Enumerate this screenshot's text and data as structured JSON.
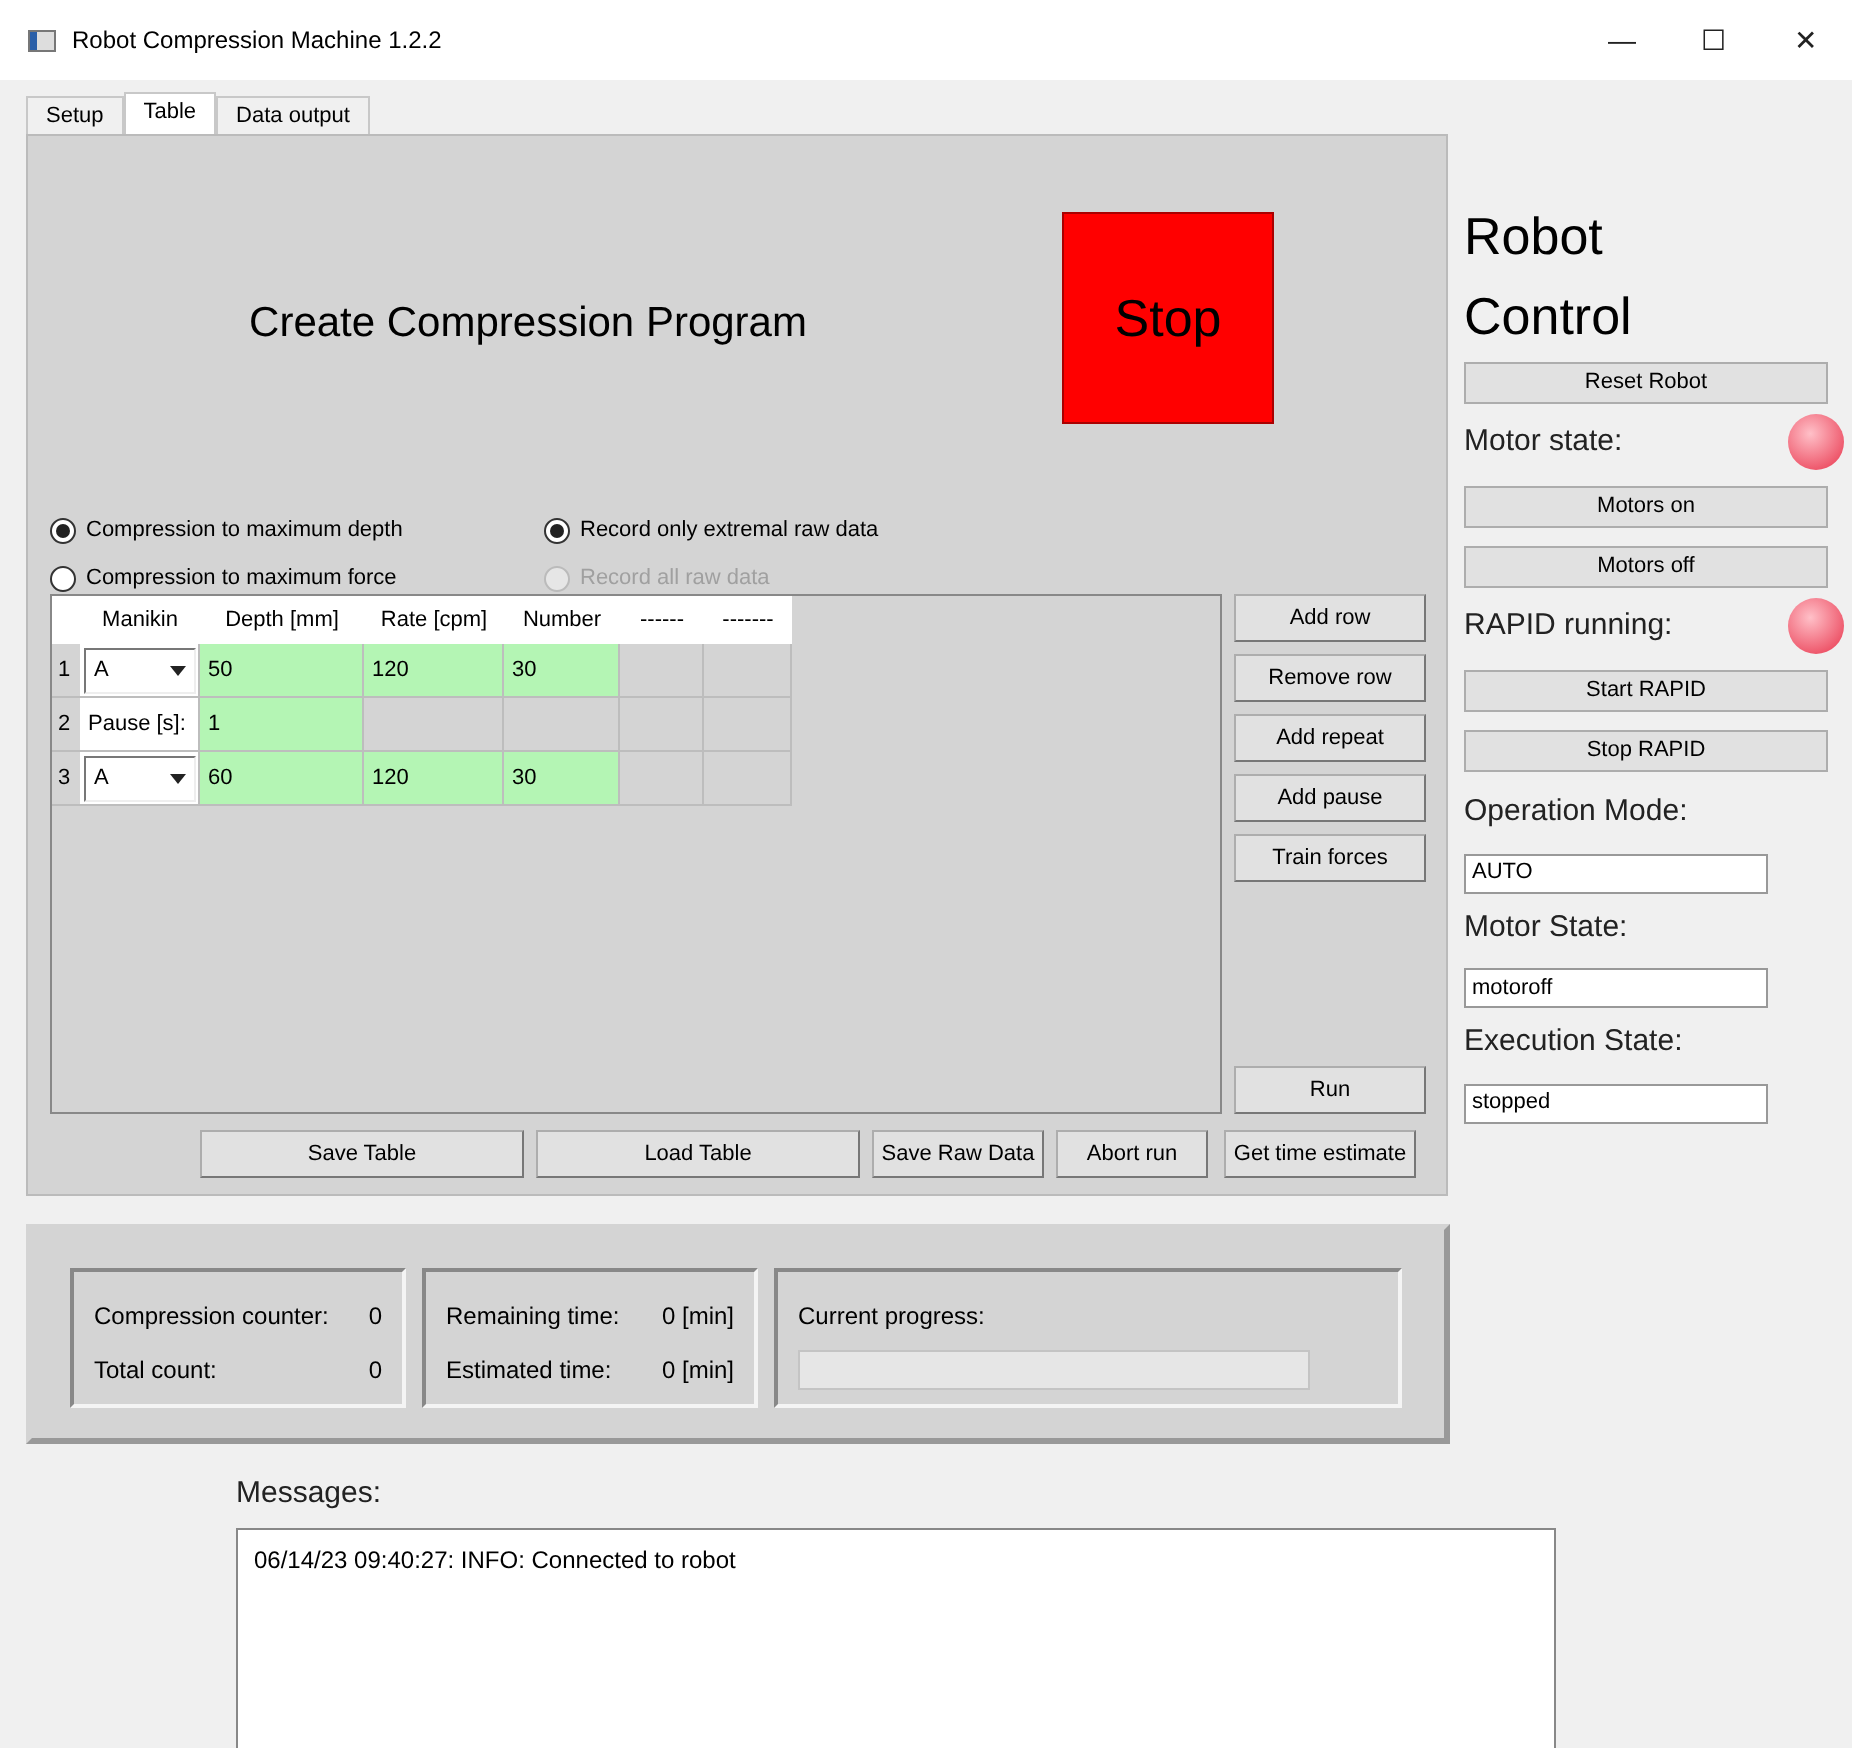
{
  "window": {
    "title": "Robot Compression Machine 1.2.2",
    "controls": [
      "—",
      "☐",
      "✕"
    ]
  },
  "tabs": [
    {
      "label": "Setup",
      "selected": false
    },
    {
      "label": "Table",
      "selected": true
    },
    {
      "label": "Data output",
      "selected": false
    }
  ],
  "program": {
    "heading": "Create Compression Program",
    "stop_button": "Stop",
    "mode_options": [
      {
        "label": "Compression to maximum depth",
        "selected": true,
        "disabled": false
      },
      {
        "label": "Compression to maximum force",
        "selected": false,
        "disabled": false
      }
    ],
    "record_options": [
      {
        "label": "Record only extremal raw data",
        "selected": true,
        "disabled": false
      },
      {
        "label": "Record all raw data",
        "selected": false,
        "disabled": true
      }
    ],
    "table": {
      "columns": [
        "Manikin",
        "Depth [mm]",
        "Rate [cpm]",
        "Number",
        "------",
        "-------"
      ],
      "rows": [
        {
          "kind": "step",
          "number": "1",
          "manikin": "A",
          "values": [
            "50",
            "120",
            "30"
          ]
        },
        {
          "kind": "pause",
          "number": "2",
          "label": "Pause [s]:",
          "values": [
            "1"
          ]
        },
        {
          "kind": "step",
          "number": "3",
          "manikin": "A",
          "values": [
            "60",
            "120",
            "30"
          ]
        }
      ]
    },
    "side_buttons": [
      "Add row",
      "Remove row",
      "Add repeat",
      "Add pause",
      "Train forces"
    ],
    "run_button": "Run",
    "bottom_buttons": [
      "Save Table",
      "Load Table",
      "Save Raw Data",
      "Abort run",
      "Get time estimate"
    ]
  },
  "robot_control": {
    "title": "Robot Control",
    "items": [
      {
        "kind": "button",
        "label": "Reset Robot"
      },
      {
        "kind": "indicator",
        "label": "Motor state:",
        "on": false
      },
      {
        "kind": "button",
        "label": "Motors on"
      },
      {
        "kind": "button",
        "label": "Motors off"
      },
      {
        "kind": "indicator",
        "label": "RAPID running:",
        "on": false
      },
      {
        "kind": "button",
        "label": "Start RAPID"
      },
      {
        "kind": "button",
        "label": "Stop RAPID"
      },
      {
        "kind": "field",
        "label": "Operation Mode:",
        "value": "AUTO"
      },
      {
        "kind": "field",
        "label": "Motor State:",
        "value": "motoroff"
      },
      {
        "kind": "field",
        "label": "Execution State:",
        "value": "stopped"
      }
    ]
  },
  "status": {
    "groups": [
      {
        "rows": [
          {
            "label": "Compression counter:",
            "value": "0"
          },
          {
            "label": "Total count:",
            "value": "0"
          }
        ]
      },
      {
        "rows": [
          {
            "label": "Remaining time:",
            "value": "0 [min]"
          },
          {
            "label": "Estimated time:",
            "value": "0 [min]"
          }
        ]
      }
    ],
    "progress": {
      "label": "Current progress:",
      "level": 0
    }
  },
  "messages": {
    "label": "Messages:",
    "lines": [
      "06/14/23 09:40:27: INFO: Connected to robot"
    ]
  }
}
